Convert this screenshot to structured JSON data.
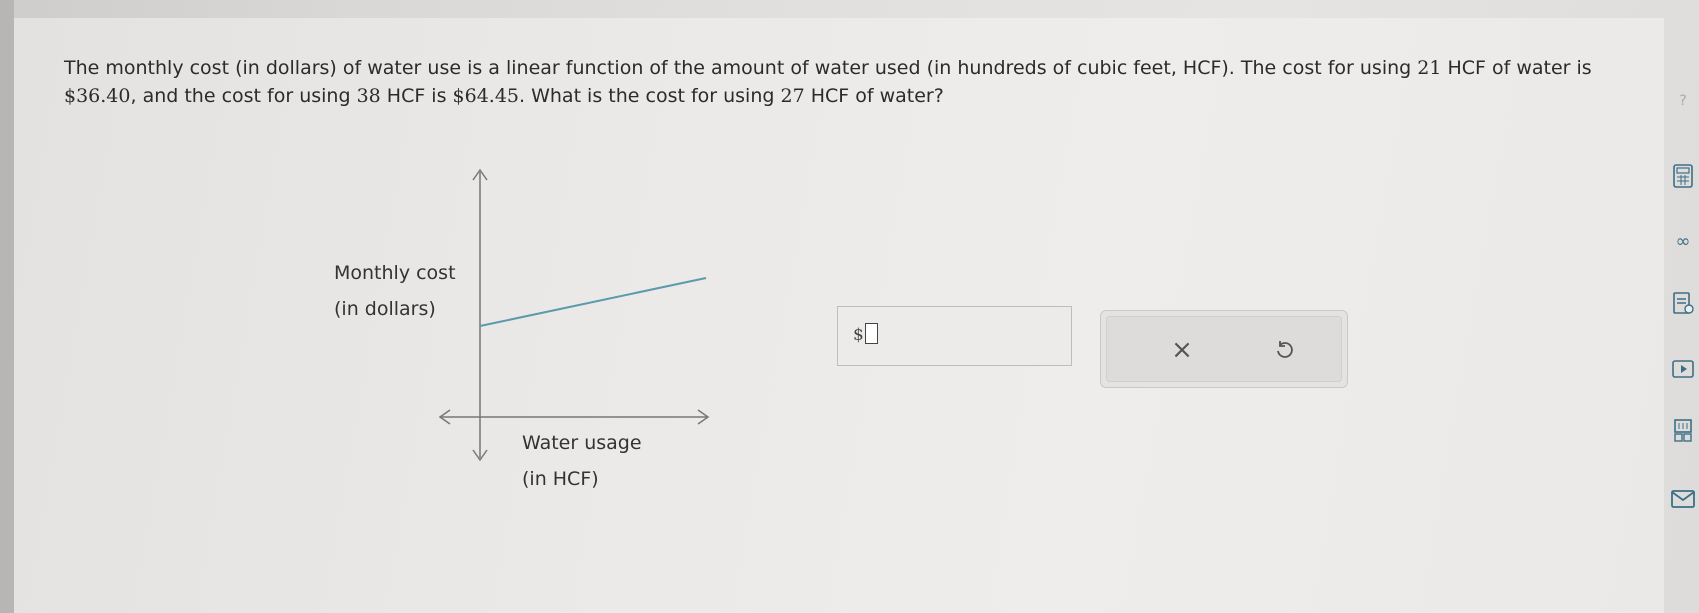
{
  "question": {
    "part1": "The monthly cost (in dollars) of water use is a linear function of the amount of water used (in hundreds of cubic feet, HCF). The cost for using ",
    "n1": "21",
    "part2": " HCF of water is",
    "amount1": "$36.40",
    "part3": ", and the cost for using ",
    "n2": "38",
    "part4": " HCF is ",
    "amount2": "$64.45",
    "part5": ". What is the cost for using ",
    "n3": "27",
    "part6": " HCF of water?"
  },
  "graph": {
    "y_label_line1": "Monthly cost",
    "y_label_line2": "(in dollars)",
    "x_label_line1": "Water usage",
    "x_label_line2": "(in HCF)"
  },
  "answer": {
    "currency_symbol": "$",
    "value": ""
  },
  "actions": {
    "clear_icon": "×",
    "undo_icon": "undo-icon"
  },
  "sidebar_icons": [
    "help-icon",
    "calculator-icon",
    "infinity-icon",
    "textbook-icon",
    "video-icon",
    "periodic-table-icon",
    "mail-icon"
  ],
  "colors": {
    "line": "#5a9aaa",
    "axis": "#777777",
    "accent": "#3c6f86"
  }
}
